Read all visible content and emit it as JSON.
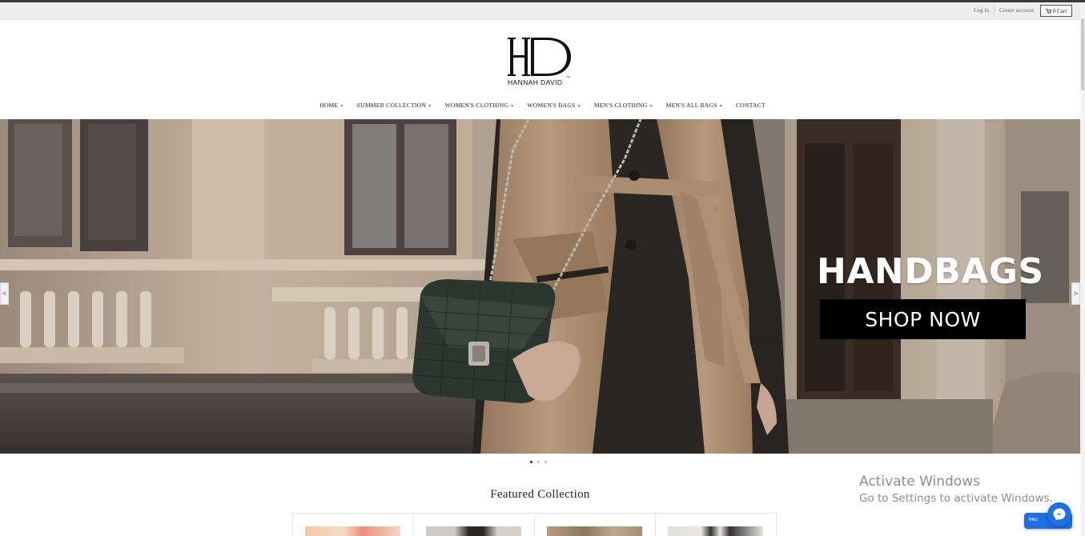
{
  "topbar": {
    "login_label": "Log in",
    "create_account_label": "Create account",
    "cart_label": "0 Cart"
  },
  "brand": {
    "logo_letters": "HD",
    "logo_name": "HANNAH DAVID",
    "trademark": "TM"
  },
  "nav": {
    "items": [
      {
        "label": "HOME",
        "dropdown": true
      },
      {
        "label": "SUMMER COLLECTION",
        "dropdown": true
      },
      {
        "label": "WOMEN'S CLOTHING",
        "dropdown": true
      },
      {
        "label": "WOMEN'S BAGS",
        "dropdown": true
      },
      {
        "label": "MEN'S CLOTHING",
        "dropdown": true
      },
      {
        "label": "MEN'S ALL BAGS",
        "dropdown": true
      },
      {
        "label": "CONTACT",
        "dropdown": false
      }
    ],
    "caret": "▼"
  },
  "hero": {
    "title": "HANDBAGS",
    "cta_label": "SHOP NOW",
    "prev_label": "<",
    "next_label": ">",
    "slide_count": 3,
    "active_slide": 1
  },
  "featured": {
    "title": "Featured Collection",
    "product_count": 4
  },
  "windows_watermark": {
    "line1": "Activate Windows",
    "line2": "Go to Settings to activate Windows."
  },
  "messenger": {
    "label": "Mes"
  },
  "colors": {
    "topbar_bg": "#ededed",
    "cta_bg": "#000000",
    "messenger_blue": "#1f6fe0"
  }
}
